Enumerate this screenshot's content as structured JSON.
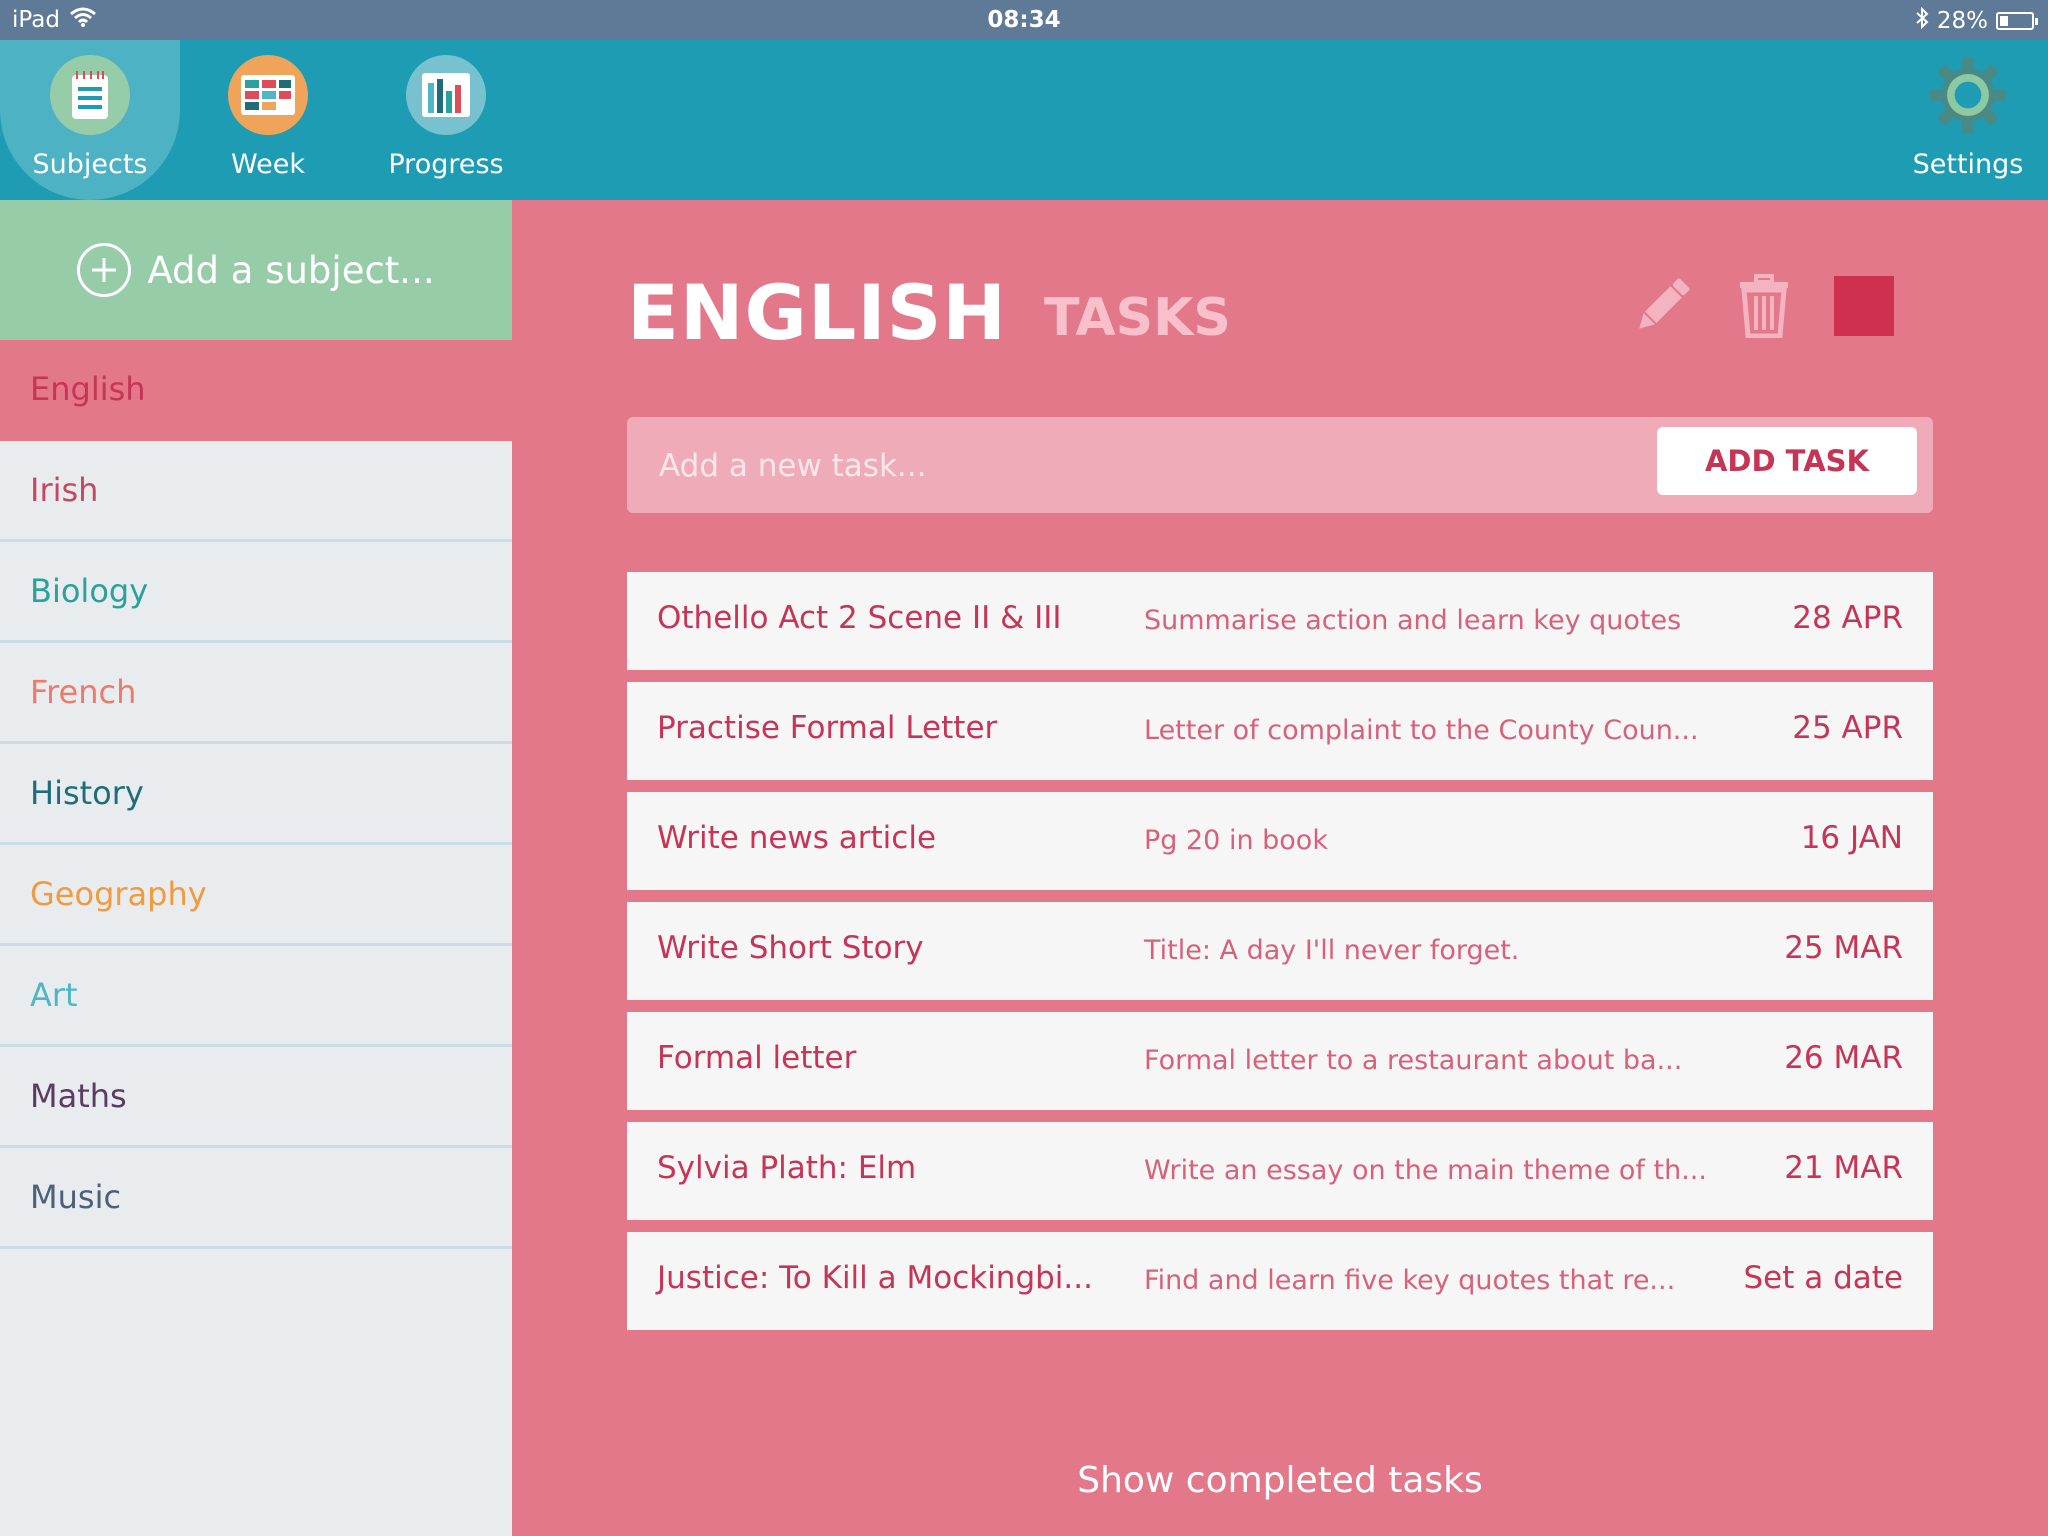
{
  "status_bar": {
    "device": "iPad",
    "time": "08:34",
    "battery": "28%",
    "battery_level": 0.28
  },
  "nav": {
    "subjects": "Subjects",
    "week": "Week",
    "progress": "Progress",
    "settings": "Settings"
  },
  "sidebar": {
    "add_subject": "Add a subject...",
    "subjects": [
      {
        "label": "English",
        "color": "#c63556"
      },
      {
        "label": "Irish",
        "color": "#c6485f"
      },
      {
        "label": "Biology",
        "color": "#2aa19c"
      },
      {
        "label": "French",
        "color": "#ec7b6b"
      },
      {
        "label": "History",
        "color": "#1e6d79"
      },
      {
        "label": "Geography",
        "color": "#f29a3e"
      },
      {
        "label": "Art",
        "color": "#4fb6c6"
      },
      {
        "label": "Maths",
        "color": "#5b3b63"
      },
      {
        "label": "Music",
        "color": "#4e5f7a"
      }
    ]
  },
  "main": {
    "title": "ENGLISH",
    "tab": "TASKS",
    "accent_color": "#d0304f",
    "new_task_placeholder": "Add a new task...",
    "add_task_label": "ADD TASK",
    "tasks": [
      {
        "title": "Othello Act 2 Scene II & III",
        "desc": "Summarise action and learn key quotes",
        "date": "28 APR"
      },
      {
        "title": "Practise Formal Letter",
        "desc": "Letter of complaint to the County Coun...",
        "date": "25 APR"
      },
      {
        "title": "Write news article",
        "desc": "Pg 20 in book",
        "date": "16 JAN"
      },
      {
        "title": "Write Short Story",
        "desc": "Title: A day I'll never forget.",
        "date": "25 MAR"
      },
      {
        "title": "Formal letter",
        "desc": "Formal letter to a restaurant about ba...",
        "date": "26 MAR"
      },
      {
        "title": "Sylvia Plath: Elm",
        "desc": "Write an essay on the main theme of th...",
        "date": "21 MAR"
      },
      {
        "title": "Justice: To Kill a Mockingbi...",
        "desc": "Find and learn five key quotes that re...",
        "date": "Set a date"
      }
    ],
    "show_completed": "Show completed tasks"
  }
}
